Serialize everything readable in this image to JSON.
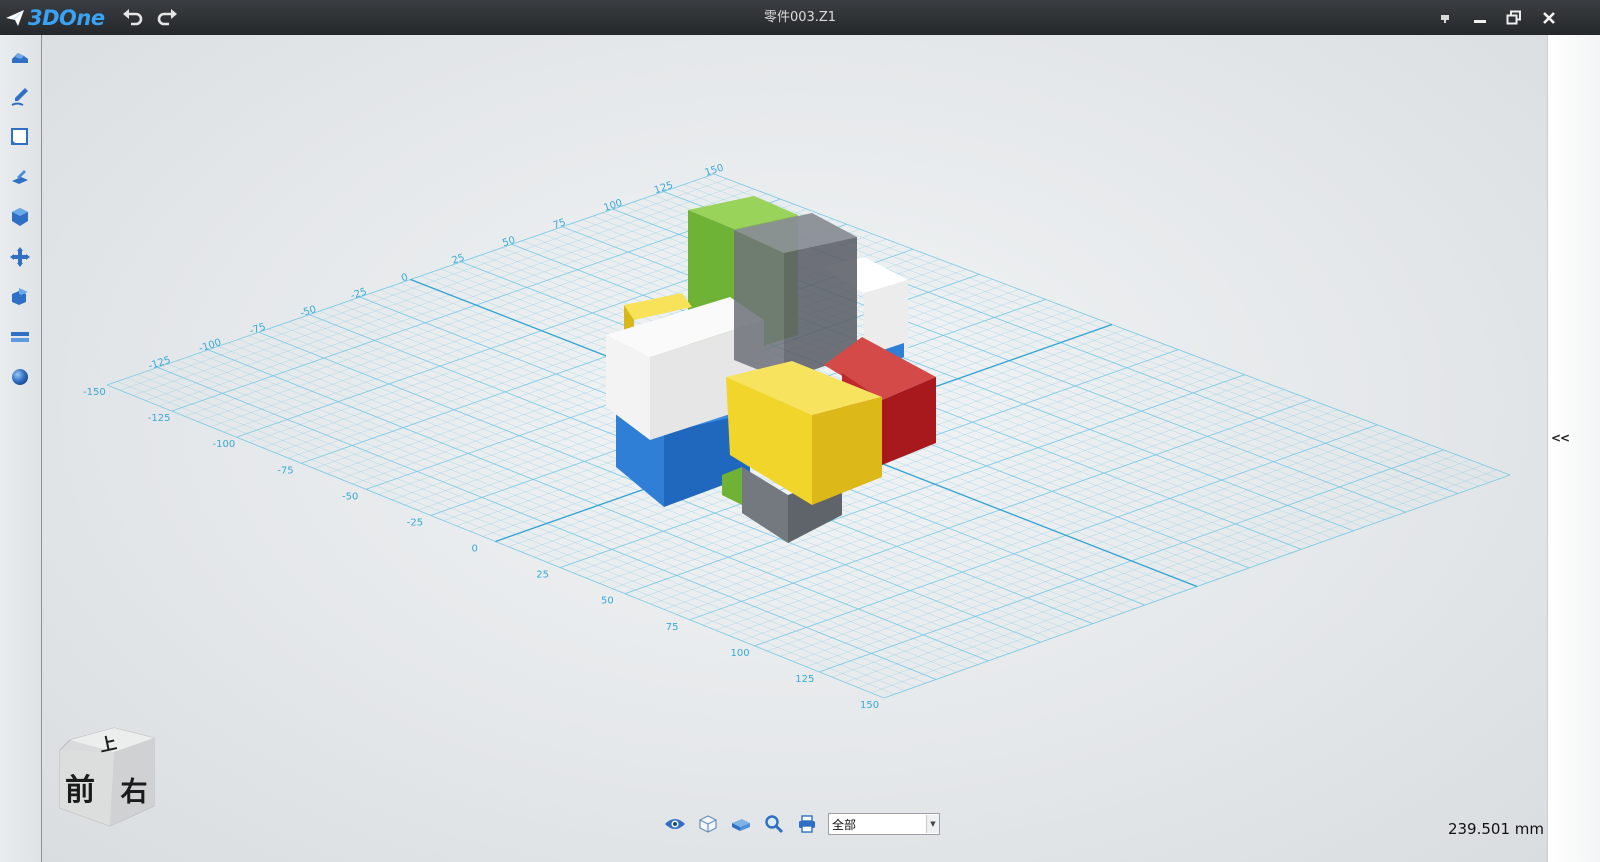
{
  "app": {
    "name": "3DOne",
    "window_title": "零件003.Z1"
  },
  "toolbar": {
    "tools": [
      {
        "icon": "shape-primitives-icon"
      },
      {
        "icon": "sketch-pen-icon"
      },
      {
        "icon": "sketch-edit-icon"
      },
      {
        "icon": "feature-pull-icon"
      },
      {
        "icon": "special-function-icon"
      },
      {
        "icon": "basic-edit-move-icon"
      },
      {
        "icon": "combine-icon"
      },
      {
        "icon": "measure-distance-icon"
      },
      {
        "icon": "material-render-icon"
      }
    ]
  },
  "grid": {
    "axis_a_labels": [
      "-150",
      "-125",
      "-100",
      "-75",
      "-50",
      "-25",
      "0",
      "25",
      "50",
      "75",
      "100",
      "125",
      "150"
    ],
    "axis_b_labels": [
      "-125",
      "-100",
      "-75",
      "-50",
      "-25",
      "0",
      "25",
      "50",
      "75",
      "100",
      "125",
      "150"
    ]
  },
  "view_cube": {
    "top": "上",
    "front": "前",
    "right": "右"
  },
  "bottom_bar": {
    "filter_value": "全部"
  },
  "collapse_label": "<<",
  "measurement": "239.501 mm",
  "colors": {
    "grid": "#6fc6e6",
    "green": "#7cc242",
    "gray": "#6c7078",
    "white": "#f3f3f3",
    "blue": "#2f7fd6",
    "yellow": "#f2d52b",
    "red": "#c0282c"
  }
}
